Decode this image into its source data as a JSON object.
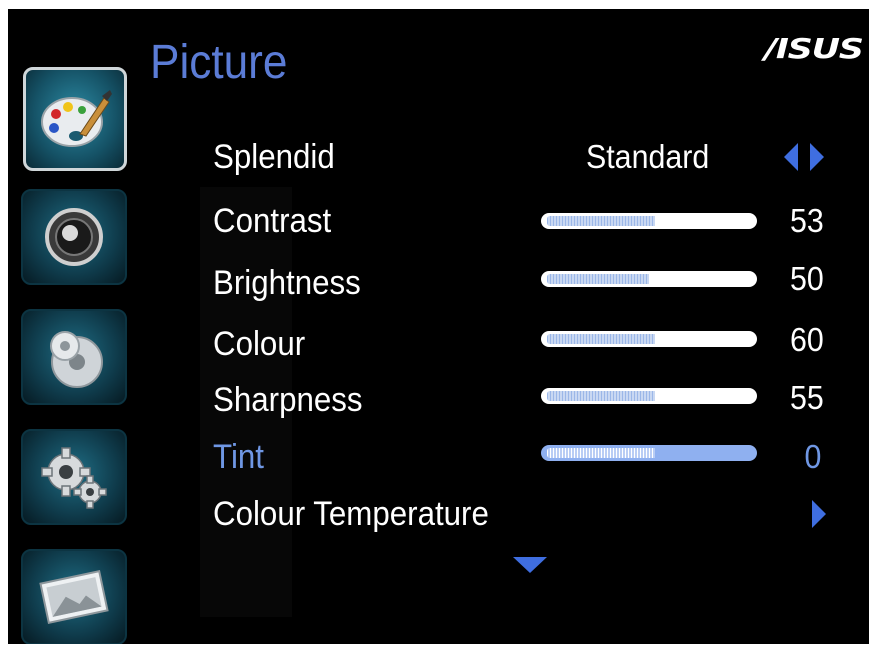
{
  "brand": "/ISUS",
  "page_title": "Picture",
  "sidebar": {
    "items": [
      {
        "name": "picture",
        "icon": "palette-icon",
        "active": true
      },
      {
        "name": "sound",
        "icon": "speaker-icon",
        "active": false
      },
      {
        "name": "input",
        "icon": "disc-icon",
        "active": false
      },
      {
        "name": "setup",
        "icon": "gears-icon",
        "active": false
      },
      {
        "name": "image",
        "icon": "image-frame-icon",
        "active": false
      }
    ]
  },
  "menu": {
    "splendid": {
      "label": "Splendid",
      "value": "Standard"
    },
    "contrast": {
      "label": "Contrast",
      "value": "53",
      "level": 0.53
    },
    "brightness": {
      "label": "Brightness",
      "value": "50",
      "level": 0.5
    },
    "colour": {
      "label": "Colour",
      "value": "60",
      "level": 0.53
    },
    "sharpness": {
      "label": "Sharpness",
      "value": "55",
      "level": 0.53
    },
    "tint": {
      "label": "Tint",
      "value": "0",
      "level": 0.53,
      "selected": true
    },
    "colour_temperature": {
      "label": "Colour Temperature"
    }
  },
  "colors": {
    "accent": "#5b7cd6",
    "selected_text": "#6f97e4",
    "arrow": "#3f6ee0",
    "background": "#000000"
  }
}
